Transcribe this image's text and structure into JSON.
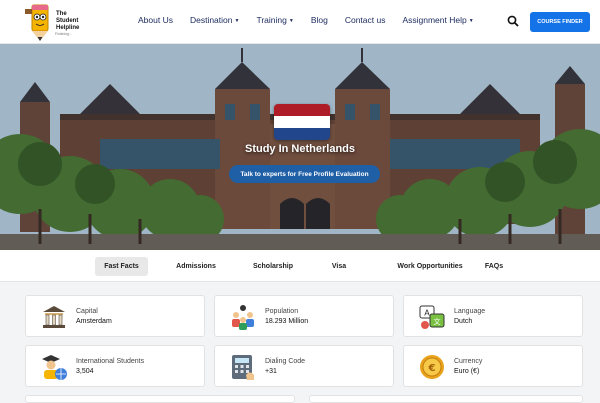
{
  "header": {
    "logo_title": "The Student Helpline",
    "logo_line1": "The",
    "logo_line2": "Student",
    "logo_line3": "Helpline",
    "logo_sub": "Finishing...",
    "nav": [
      {
        "label": "About Us",
        "dropdown": false
      },
      {
        "label": "Destination",
        "dropdown": true
      },
      {
        "label": "Training",
        "dropdown": true
      },
      {
        "label": "Blog",
        "dropdown": false
      },
      {
        "label": "Contact us",
        "dropdown": false
      },
      {
        "label": "Assignment Help",
        "dropdown": true
      }
    ],
    "search_icon": "search-icon",
    "cta_label": "COURSE FINDER",
    "accent": "#1473e6"
  },
  "hero": {
    "title": "Study In Netherlands",
    "cta_label": "Talk to experts for Free Profile Evaluation",
    "flag_colors": [
      "#ae1c28",
      "#ffffff",
      "#21468b"
    ]
  },
  "tabs": [
    {
      "label": "Fast Facts",
      "active": true
    },
    {
      "label": "Admissions",
      "active": false
    },
    {
      "label": "Scholarship",
      "active": false
    },
    {
      "label": "Visa",
      "active": false
    },
    {
      "label": "Work Opportunities",
      "active": false
    },
    {
      "label": "FAQs",
      "active": false
    }
  ],
  "facts": [
    {
      "label": "Capital",
      "value": "Amsterdam",
      "icon": "government-building-icon"
    },
    {
      "label": "Population",
      "value": "18.293 Million",
      "icon": "people-group-icon"
    },
    {
      "label": "Language",
      "value": "Dutch",
      "icon": "language-icon"
    },
    {
      "label": "International Students",
      "value": "3,504",
      "icon": "student-globe-icon"
    },
    {
      "label": "Dialing Code",
      "value": "+31",
      "icon": "calculator-phone-icon"
    },
    {
      "label": "Currency",
      "value": "Euro (€)",
      "icon": "coin-icon"
    }
  ]
}
